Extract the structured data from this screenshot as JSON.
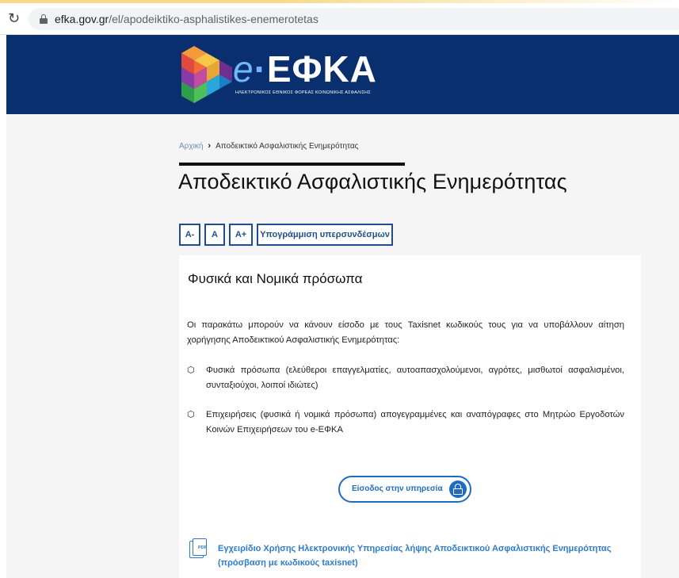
{
  "browser": {
    "url_host": "efka.gov.gr",
    "url_path": "/el/apodeiktiko-asphalistikes-enemerotetas"
  },
  "header": {
    "logo_prefix": "e",
    "logo_dot": "·",
    "logo_name": "ΕΦΚΑ",
    "logo_subtitle": "ΗΛΕΚΤΡΟΝΙΚΟΣ ΕΘΝΙΚΟΣ ΦΟΡΕΑΣ ΚΟΙΝΩΝΙΚΗΣ ΑΣΦΑΛΙΣΗΣ",
    "colors": {
      "band": "#0a2f6e",
      "accent": "#6fb7ff"
    }
  },
  "breadcrumb": {
    "home": "Αρχική",
    "separator": "›",
    "current": "Αποδεικτικό Ασφαλιστικής Ενημερότητας"
  },
  "page": {
    "title": "Αποδεικτικό Ασφαλιστικής Ενημερότητας"
  },
  "accessibility": {
    "decrease": "A-",
    "normal": "A",
    "increase": "A+",
    "underline_links": "Υπογράμμιση υπερσυνδέσμων"
  },
  "section": {
    "title": "Φυσικά και Νομικά πρόσωπα",
    "intro": "Οι παρακάτω μπορούν να κάνουν είσοδο με τους Taxisnet κωδικούς τους για να υποβάλλουν αίτηση χορήγησης Αποδεικτικού Ασφαλιστικής Ενημερότητας:",
    "bullets": [
      "Φυσικά πρόσωπα (ελεύθεροι επαγγελματίες, αυτοαπασχολούμενοι, αγρότες, μισθωτοί ασφαλισμένοι, συνταξιούχοι, λοιποί ιδιώτες)",
      "Επιχειρήσεις (φυσικά ή νομικά πρόσωπα) απογεγραμμένες και αναπόγραφες στο Μητρώο Εργοδοτών Κοινών Επιχειρήσεων του e-ΕΦΚΑ"
    ],
    "login_button": "Είσοδος στην υπηρεσία",
    "pdf_label": "PDF",
    "manual_link": "Εγχειρίδιο Χρήσης Ηλεκτρονικής Υπηρεσίας λήψης Αποδεικτικού Ασφαλιστικής Ενημερότητας (πρόσβαση με κωδικούς taxisnet)"
  }
}
